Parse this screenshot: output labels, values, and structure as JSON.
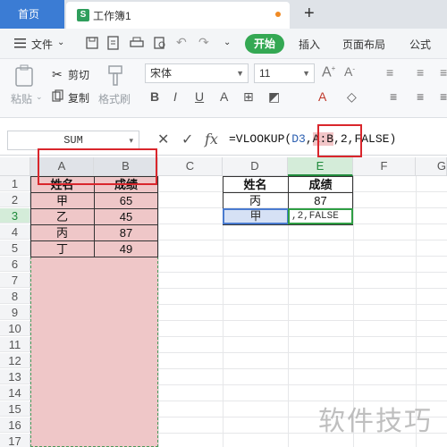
{
  "tabs": {
    "home": "首页",
    "document": "工作簿1",
    "doc_icon_letter": "S",
    "new_tab": "+"
  },
  "menu": {
    "file": "文件",
    "start": "开始",
    "insert": "插入",
    "page_layout": "页面布局",
    "formula": "公式"
  },
  "ribbon": {
    "paste": "粘贴",
    "cut": "剪切",
    "copy": "复制",
    "format_painter": "格式刷",
    "font_name": "宋体",
    "font_size": "11"
  },
  "formula_bar": {
    "name_box": "SUM",
    "cancel": "✕",
    "confirm": "✓",
    "fx": "fx",
    "formula_prefix": "=VLOOKUP(",
    "ref_d3": "D3",
    "comma1": ",",
    "ref_range": "A:B",
    "formula_suffix": ",2,FALSE)"
  },
  "columns": [
    "A",
    "B",
    "C",
    "D",
    "E",
    "F",
    "G"
  ],
  "rows": [
    "1",
    "2",
    "3",
    "4",
    "5",
    "6",
    "7",
    "8",
    "9",
    "10",
    "11",
    "12",
    "13",
    "14",
    "15",
    "16",
    "17"
  ],
  "table1": {
    "header": [
      "姓名",
      "成绩"
    ],
    "rows": [
      [
        "甲",
        "65"
      ],
      [
        "乙",
        "45"
      ],
      [
        "丙",
        "87"
      ],
      [
        "丁",
        "49"
      ]
    ]
  },
  "table2": {
    "header": [
      "姓名",
      "成绩"
    ],
    "rows": [
      [
        "丙",
        "87"
      ]
    ],
    "lookup_value": "甲",
    "editing_text": ",2,FALSE"
  },
  "watermark": "软件技巧",
  "colors": {
    "accent_blue": "#3b7cd4",
    "start_green": "#34a853",
    "selection_fill": "#efc7c8",
    "highlight_red": "#d9262c"
  }
}
